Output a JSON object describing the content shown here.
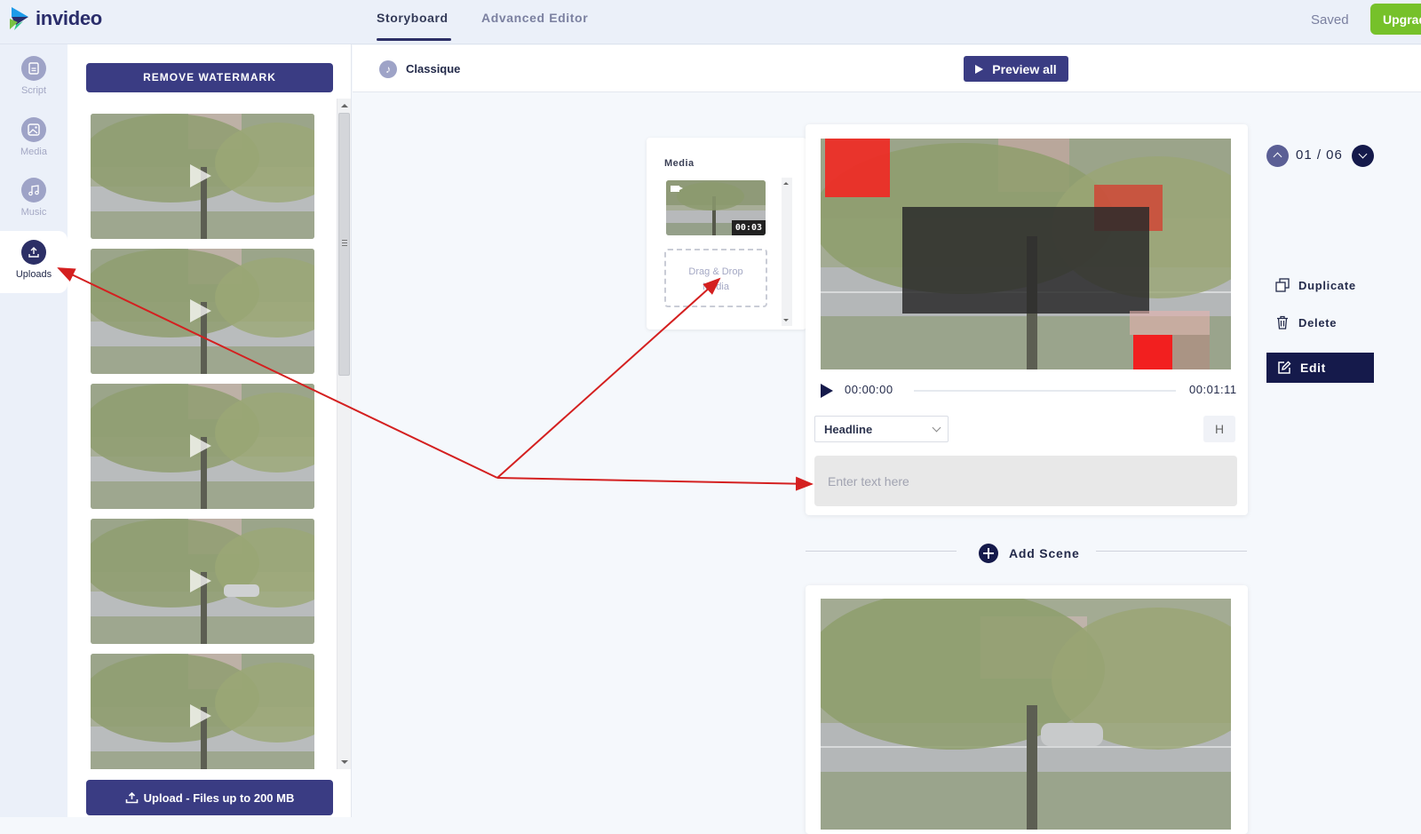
{
  "app": {
    "name": "invideo",
    "tabs": [
      {
        "label": "Storyboard",
        "active": true
      },
      {
        "label": "Advanced Editor",
        "active": false
      }
    ],
    "status": "Saved",
    "upgrade_label": "Upgrade"
  },
  "rail": {
    "items": [
      {
        "label": "Script",
        "icon": "document-icon",
        "active": false
      },
      {
        "label": "Media",
        "icon": "image-icon",
        "active": false
      },
      {
        "label": "Music",
        "icon": "music-note-icon",
        "active": false
      },
      {
        "label": "Uploads",
        "icon": "upload-icon",
        "active": true
      }
    ]
  },
  "uploads_panel": {
    "remove_watermark_label": "REMOVE WATERMARK",
    "upload_label": "Upload - Files up to 200 MB",
    "thumbnails": [
      {
        "type": "video",
        "has_car": false
      },
      {
        "type": "video",
        "has_car": false
      },
      {
        "type": "video",
        "has_car": false
      },
      {
        "type": "video",
        "has_car": true
      },
      {
        "type": "video",
        "has_car": false
      }
    ]
  },
  "subheader": {
    "music_track": "Classique",
    "preview_label": "Preview all"
  },
  "media_popup": {
    "title": "Media",
    "clip_duration": "00:03",
    "dropzone_line1": "Drag & Drop",
    "dropzone_line2": "Media"
  },
  "scene": {
    "current_time": "00:00:00",
    "end_time": "00:01:11",
    "text_style": "Headline",
    "h_button": "H",
    "text_placeholder": "Enter text here",
    "text_value": ""
  },
  "scene_nav": {
    "counter": "01 / 06"
  },
  "scene_actions": {
    "duplicate_label": "Duplicate",
    "delete_label": "Delete",
    "edit_label": "Edit"
  },
  "add_scene_label": "Add Scene",
  "colors": {
    "brand_navy": "#3a3c83",
    "dark_navy": "#151a4b",
    "upgrade_green": "#76c12a",
    "annotation_red": "#d42020",
    "overlay_red": "#f02020"
  }
}
